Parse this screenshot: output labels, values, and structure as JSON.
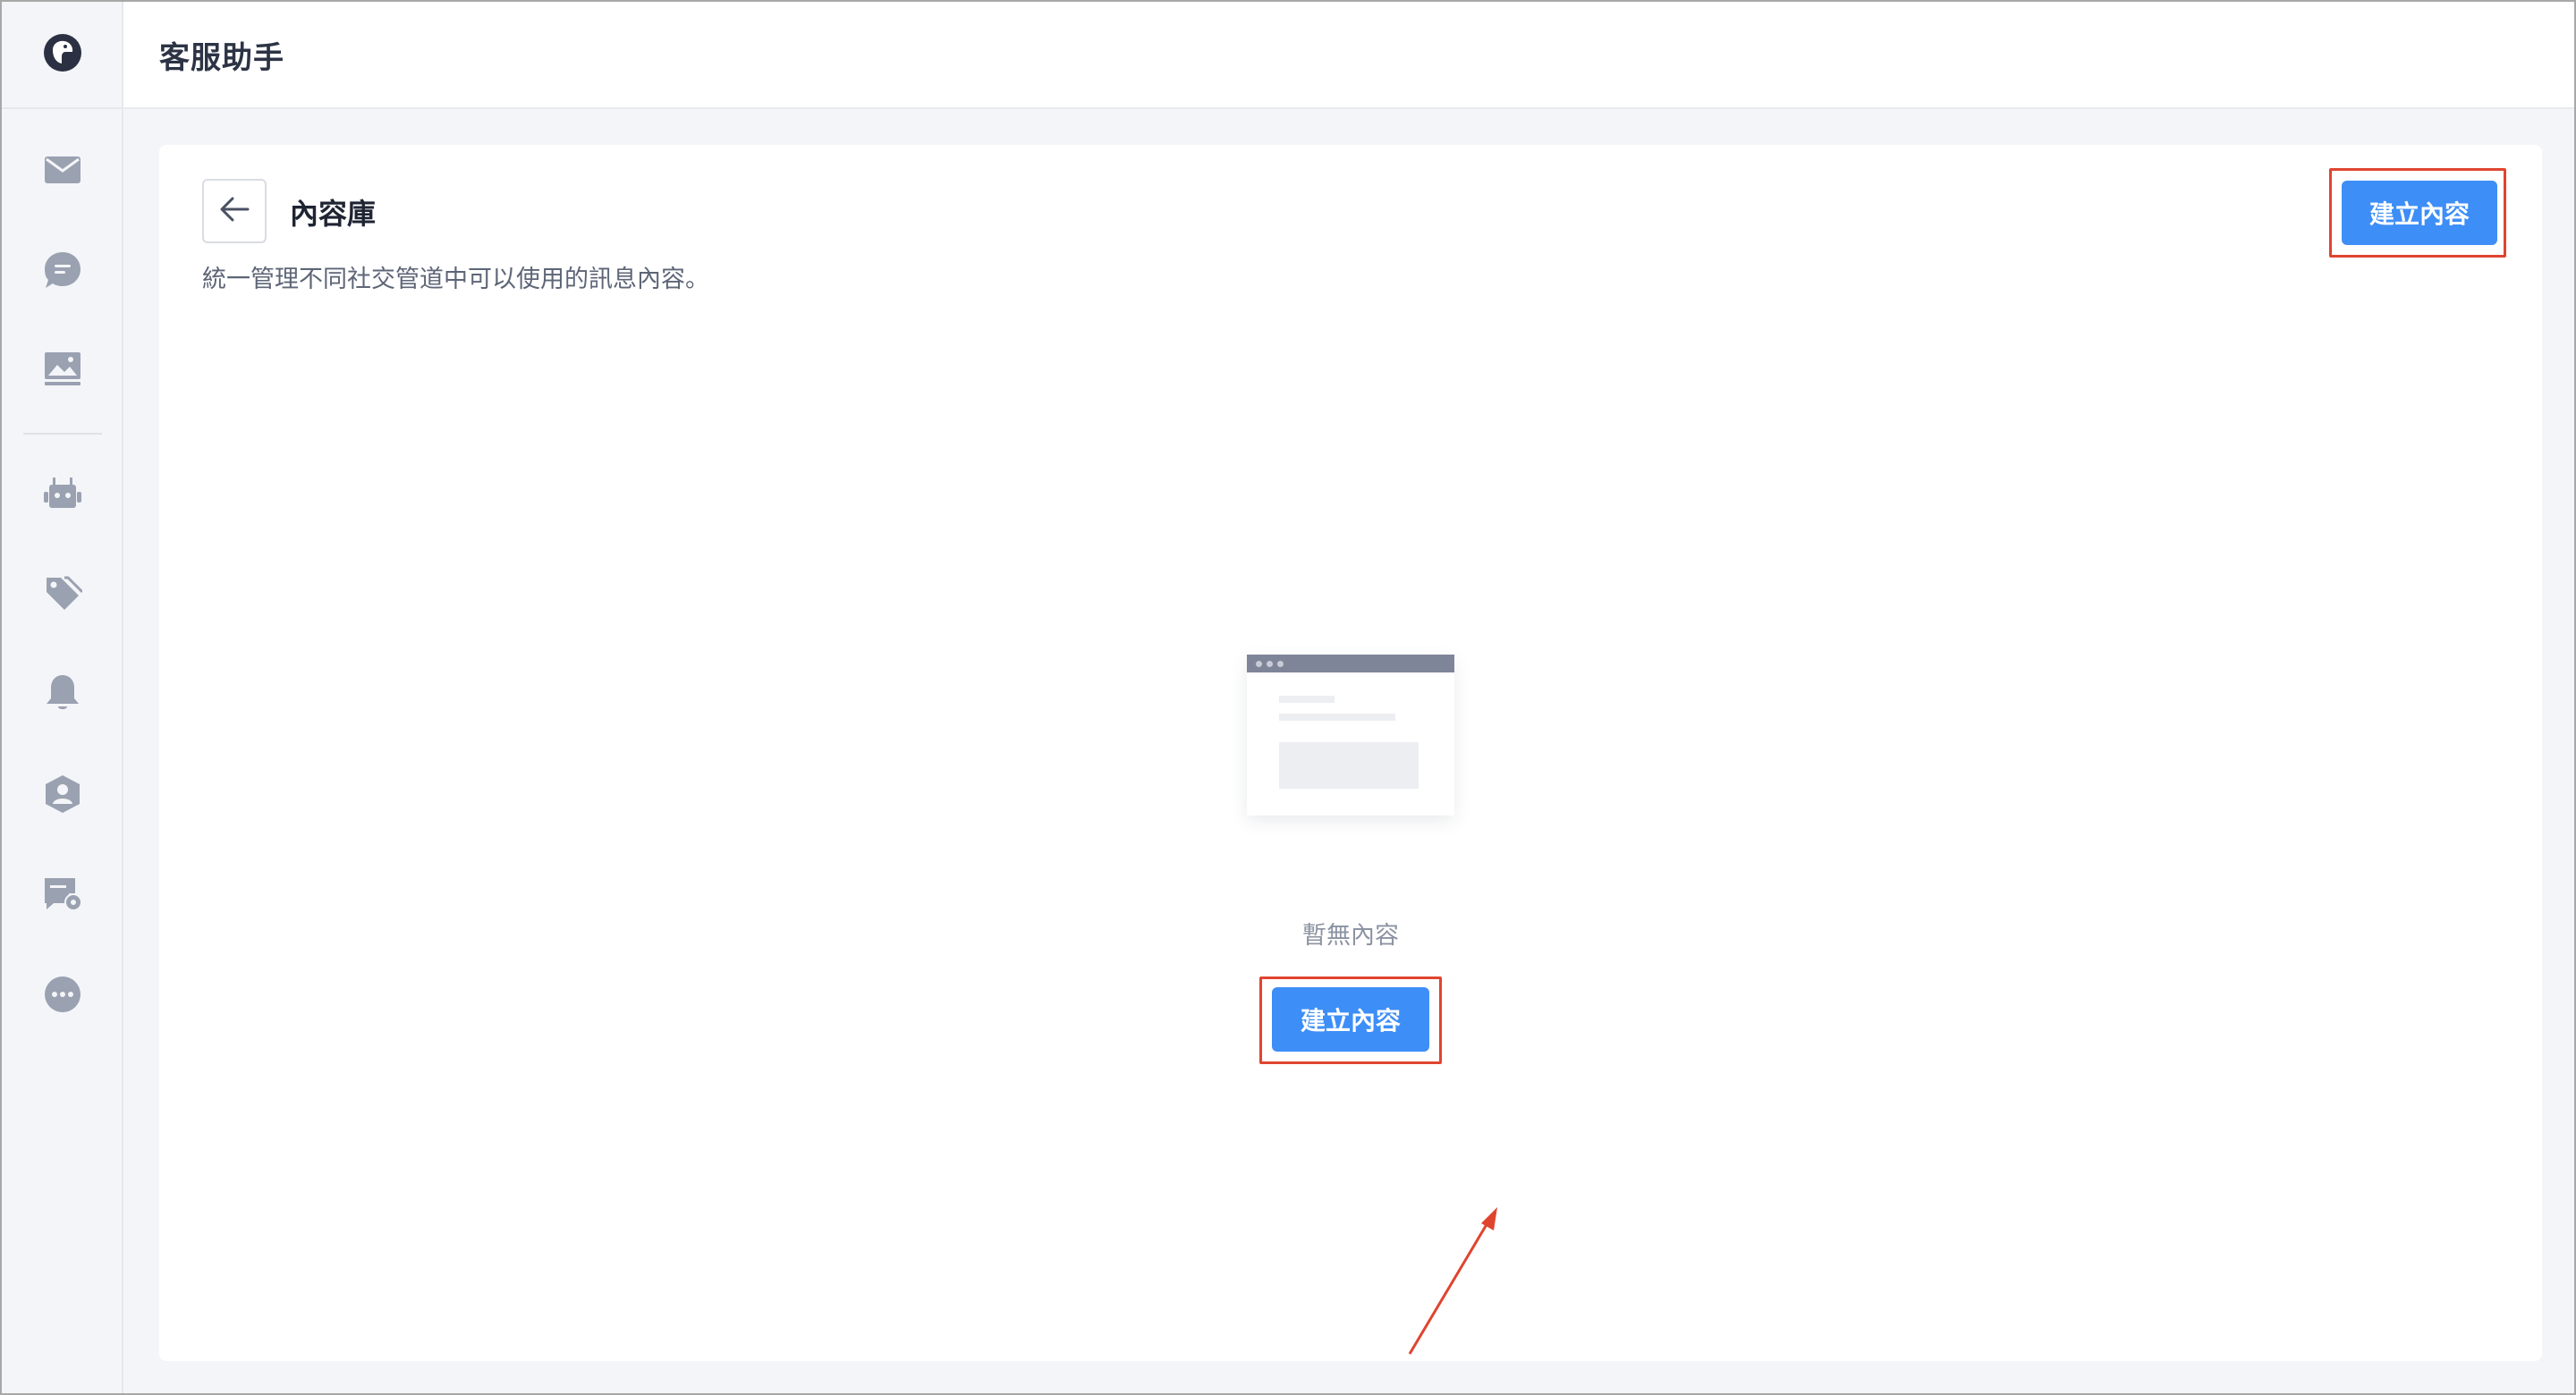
{
  "app": {
    "title": "客服助手"
  },
  "sidebar": {
    "items": [
      {
        "icon": "envelope-icon"
      },
      {
        "icon": "chat-bubble-icon"
      },
      {
        "icon": "image-gallery-icon"
      },
      {
        "icon": "bot-icon"
      },
      {
        "icon": "tags-icon"
      },
      {
        "icon": "bell-icon"
      },
      {
        "icon": "user-shield-icon"
      },
      {
        "icon": "chat-settings-icon"
      },
      {
        "icon": "more-icon"
      }
    ]
  },
  "page": {
    "title": "內容庫",
    "description": "統一管理不同社交管道中可以使用的訊息內容。",
    "create_button_label": "建立內容"
  },
  "empty_state": {
    "message": "暫無內容",
    "create_button_label": "建立內容"
  },
  "colors": {
    "primary": "#3d8ef7",
    "annotation_red": "#e0442f",
    "sidebar_icon": "#9aa1b1"
  }
}
